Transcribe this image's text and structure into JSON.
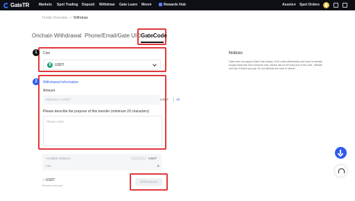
{
  "nav": {
    "logo": "GateTR",
    "items": [
      "Markets",
      "Spot Trading",
      "Deposit",
      "Withdraw",
      "Gate Learn",
      "More"
    ],
    "rewards": "Rewards Hub",
    "right_items": [
      "Assets",
      "Spot Orders"
    ]
  },
  "breadcrumb": {
    "parent": "Funds Overview",
    "separator": ">",
    "current": "Withdraw"
  },
  "tabs": [
    "Onchain Withdrawal",
    "Phone/Email/Gate UID",
    "GateCode"
  ],
  "coin_section": {
    "step": "1",
    "label": "Coin",
    "selected": "USDT",
    "coin_symbol": "₮"
  },
  "withdraw_section": {
    "step": "2",
    "title": "Withdrawal Information",
    "amount_label": "Amount",
    "amount_placeholder": "Minimum 3 USDT",
    "amount_unit": "USDT",
    "all_label": "All",
    "purpose_label": "Please describe the purpose of this transfer (minimum 20 characters)",
    "purpose_placeholder": "Please enter"
  },
  "balance": {
    "available_label": "Available Balance",
    "available_unit": "USDT",
    "fee_label": "Fee",
    "fee_value": "0"
  },
  "receive": {
    "amount": "-- USDT",
    "label": "Receive Amount"
  },
  "withdraw_button": "Withdrawal",
  "notices": {
    "title": "Notices",
    "text": "Gate does not support GateCode trading. Don't make withdrawals and if you've already bought Gatecode from someone else, please ask for the front part of the code. Validate and lock it before you pay. Do not disclose the code to others!"
  },
  "colors": {
    "highlight": "#e0353b",
    "accent": "#2f5bea",
    "nav_bg": "#0c0f14"
  }
}
